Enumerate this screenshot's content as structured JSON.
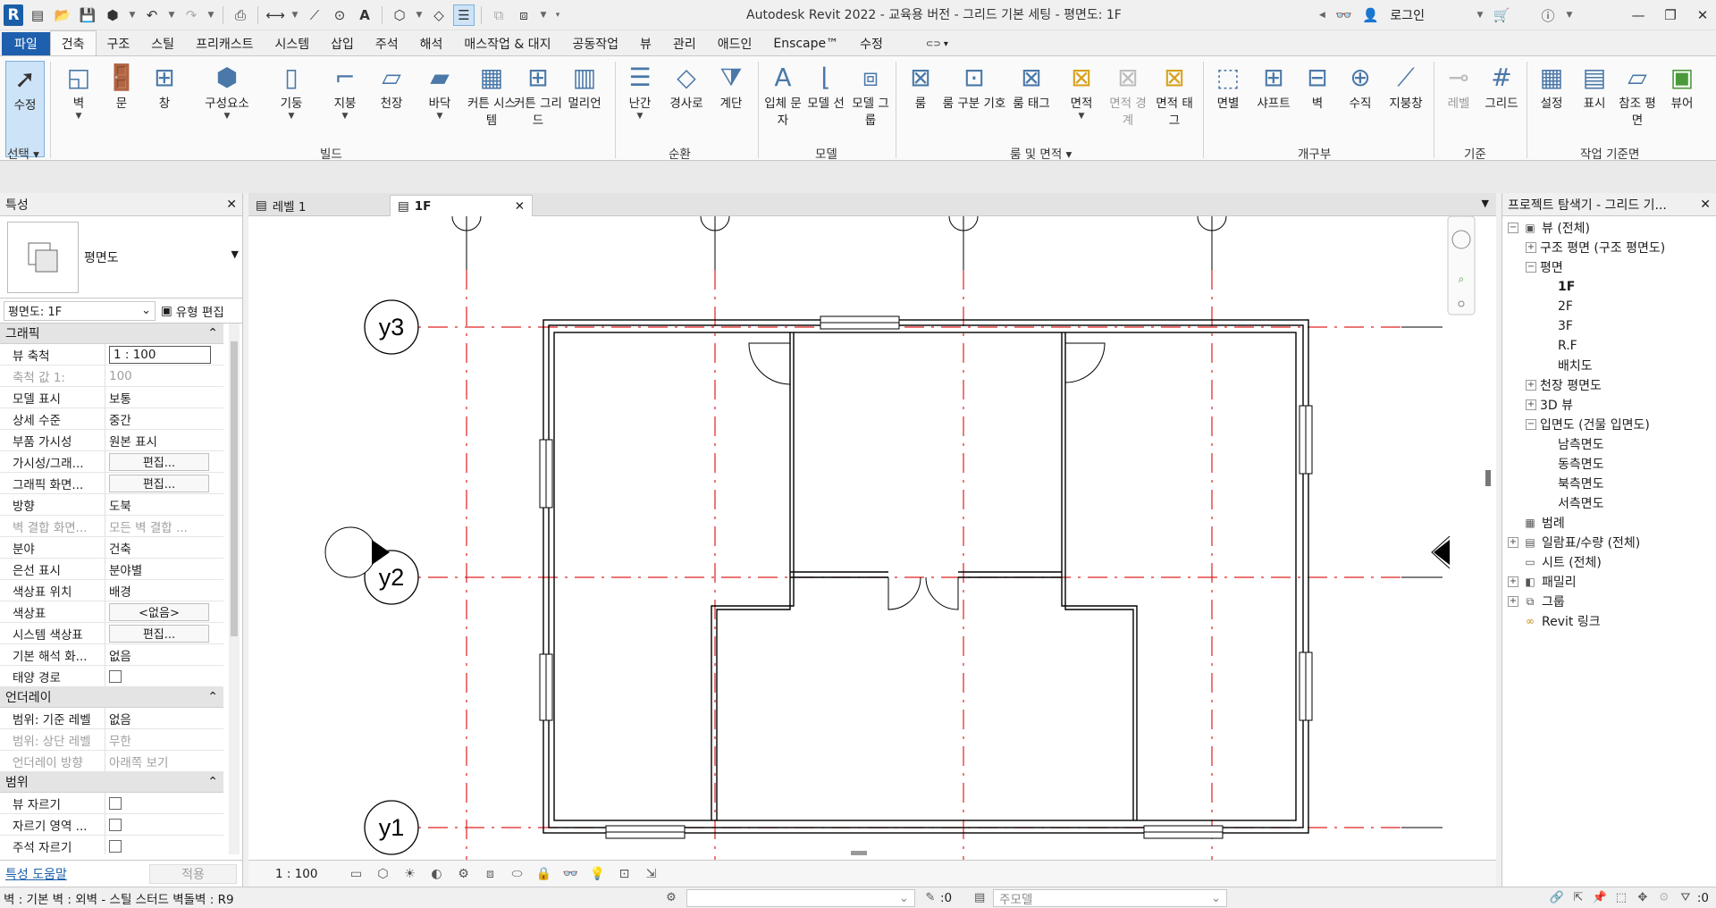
{
  "window": {
    "title": "Autodesk Revit 2022 - 교육용 버전 - 그리드 기본 세팅 - 평면도: 1F",
    "login": "로그인"
  },
  "ribbon_tabs": [
    "파일",
    "건축",
    "구조",
    "스틸",
    "프리캐스트",
    "시스템",
    "삽입",
    "주석",
    "해석",
    "매스작업 & 대지",
    "공동작업",
    "뷰",
    "관리",
    "애드인",
    "Enscape™",
    "수정"
  ],
  "ribbon": {
    "select": {
      "modify": "수정",
      "select_label": "선택"
    },
    "build": {
      "label": "빌드",
      "buttons": [
        "벽",
        "문",
        "창",
        "구성요소",
        "기둥",
        "지붕",
        "천장",
        "바닥",
        "커튼 시스템",
        "커튼 그리드",
        "멀리언"
      ]
    },
    "circulation": {
      "label": "순환",
      "buttons": [
        "난간",
        "경사로",
        "계단"
      ]
    },
    "model": {
      "label": "모델",
      "buttons": [
        "입체 문자",
        "모델 선",
        "모델 그룹"
      ]
    },
    "room_area": {
      "label": "룸 및 면적",
      "buttons": [
        "룸",
        "룸 구분 기호",
        "룸 태그",
        "면적",
        "면적 경계",
        "면적 태그"
      ]
    },
    "opening": {
      "label": "개구부",
      "buttons": [
        "면별",
        "샤프트",
        "벽",
        "수직",
        "지붕창"
      ]
    },
    "datum": {
      "label": "기준",
      "buttons": [
        "레벨",
        "그리드"
      ]
    },
    "work_plane": {
      "label": "작업 기준면",
      "buttons": [
        "설정",
        "표시",
        "참조 평면",
        "뷰어"
      ]
    }
  },
  "properties": {
    "title": "특성",
    "type_name": "평면도",
    "instance": "평면도: 1F",
    "type_edit": "유형 편집",
    "groups": [
      {
        "name": "그래픽",
        "rows": [
          {
            "name": "뷰 축척",
            "value": "1 : 100",
            "kind": "input"
          },
          {
            "name": "축척 값    1:",
            "value": "100",
            "kind": "disabled"
          },
          {
            "name": "모델 표시",
            "value": "보통"
          },
          {
            "name": "상세 수준",
            "value": "중간"
          },
          {
            "name": "부품 가시성",
            "value": "원본 표시"
          },
          {
            "name": "가시성/그래...",
            "value": "편집...",
            "kind": "button"
          },
          {
            "name": "그래픽 화면...",
            "value": "편집...",
            "kind": "button"
          },
          {
            "name": "방향",
            "value": "도북"
          },
          {
            "name": "벽 결합 화면...",
            "value": "모든 벽 결합 ...",
            "kind": "disabled"
          },
          {
            "name": "분야",
            "value": "건축"
          },
          {
            "name": "은선 표시",
            "value": "분야별"
          },
          {
            "name": "색상표 위치",
            "value": "배경"
          },
          {
            "name": "색상표",
            "value": "<없음>",
            "kind": "button"
          },
          {
            "name": "시스템 색상표",
            "value": "편집...",
            "kind": "button"
          },
          {
            "name": "기본 해석 화...",
            "value": "없음"
          },
          {
            "name": "태양 경로",
            "value": "",
            "kind": "check"
          }
        ]
      },
      {
        "name": "언더레이",
        "rows": [
          {
            "name": "범위: 기준 레벨",
            "value": "없음"
          },
          {
            "name": "범위: 상단 레벨",
            "value": "무한",
            "kind": "disabled"
          },
          {
            "name": "언더레이 방향",
            "value": "아래쪽 보기",
            "kind": "disabled"
          }
        ]
      },
      {
        "name": "범위",
        "rows": [
          {
            "name": "뷰 자르기",
            "value": "",
            "kind": "check"
          },
          {
            "name": "자르기 영역 ...",
            "value": "",
            "kind": "check"
          },
          {
            "name": "주석 자르기",
            "value": "",
            "kind": "check"
          }
        ]
      }
    ],
    "help_link": "특성 도움말",
    "apply": "적용"
  },
  "view_tabs": [
    {
      "label": "레벨 1",
      "active": false
    },
    {
      "label": "1F",
      "active": true
    }
  ],
  "canvas": {
    "grid_bubbles": [
      "y3",
      "y2",
      "y1"
    ],
    "grid_line_color": "#e02020",
    "wall_color": "#000000"
  },
  "view_control": {
    "scale": "1 : 100"
  },
  "browser": {
    "title": "프로젝트 탐색기 - 그리드 기...",
    "nodes": [
      {
        "label": "뷰 (전체)",
        "indent": 0,
        "exp": "−",
        "icon": "view-icon"
      },
      {
        "label": "구조 평면 (구조 평면도)",
        "indent": 1,
        "exp": "+"
      },
      {
        "label": "평면",
        "indent": 1,
        "exp": "−"
      },
      {
        "label": "1F",
        "indent": 2,
        "exp": "",
        "bold": true
      },
      {
        "label": "2F",
        "indent": 2,
        "exp": ""
      },
      {
        "label": "3F",
        "indent": 2,
        "exp": ""
      },
      {
        "label": "R.F",
        "indent": 2,
        "exp": ""
      },
      {
        "label": "배치도",
        "indent": 2,
        "exp": ""
      },
      {
        "label": "천장 평면도",
        "indent": 1,
        "exp": "+"
      },
      {
        "label": "3D 뷰",
        "indent": 1,
        "exp": "+"
      },
      {
        "label": "입면도 (건물 입면도)",
        "indent": 1,
        "exp": "−"
      },
      {
        "label": "남측면도",
        "indent": 2,
        "exp": ""
      },
      {
        "label": "동측면도",
        "indent": 2,
        "exp": ""
      },
      {
        "label": "북측면도",
        "indent": 2,
        "exp": ""
      },
      {
        "label": "서측면도",
        "indent": 2,
        "exp": ""
      },
      {
        "label": "범례",
        "indent": 0,
        "exp": "",
        "icon": "legend-icon"
      },
      {
        "label": "일람표/수량 (전체)",
        "indent": 0,
        "exp": "+",
        "icon": "schedule-icon"
      },
      {
        "label": "시트 (전체)",
        "indent": 0,
        "exp": "",
        "icon": "sheet-icon"
      },
      {
        "label": "패밀리",
        "indent": 0,
        "exp": "+",
        "icon": "family-icon"
      },
      {
        "label": "그룹",
        "indent": 0,
        "exp": "+",
        "icon": "group-icon"
      },
      {
        "label": "Revit 링크",
        "indent": 0,
        "exp": "",
        "icon": "link-icon"
      }
    ]
  },
  "statusbar": {
    "text": "벽 : 기본 벽 : 외벽 - 스틸 스터드 벽돌벽 : R9",
    "coord": ":0",
    "model": "주모델",
    "filter": ":0"
  }
}
